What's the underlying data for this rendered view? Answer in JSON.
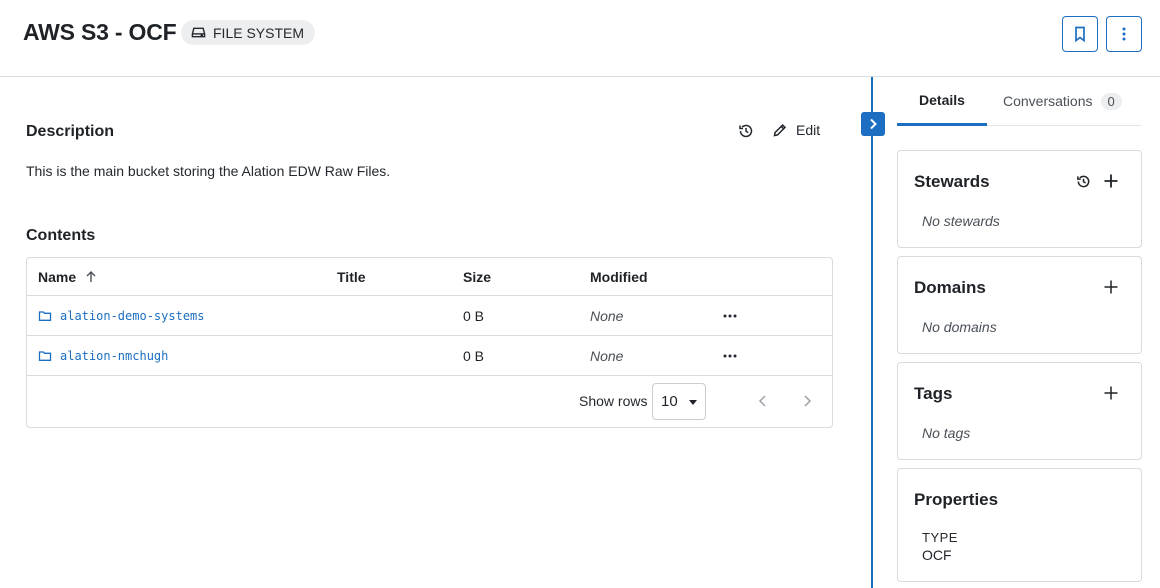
{
  "header": {
    "title": "AWS S3 - OCF",
    "type_chip": "FILE SYSTEM",
    "icons": {
      "type": "drive-icon",
      "bookmark": "bookmark-icon",
      "more": "more-vertical-icon"
    }
  },
  "description": {
    "heading": "Description",
    "text": "This is the main bucket storing the Alation EDW Raw Files.",
    "edit_label": "Edit"
  },
  "contents": {
    "heading": "Contents",
    "columns": [
      "Name",
      "Title",
      "Size",
      "Modified"
    ],
    "rows": [
      {
        "name": "alation-demo-systems",
        "title": "",
        "size": "0 B",
        "modified": "None"
      },
      {
        "name": "alation-nmchugh",
        "title": "",
        "size": "0 B",
        "modified": "None"
      }
    ],
    "pagination": {
      "show_rows_label": "Show rows",
      "rows_value": "10"
    }
  },
  "panel": {
    "tabs": [
      {
        "label": "Details",
        "active": true
      },
      {
        "label": "Conversations",
        "count": "0"
      }
    ],
    "cards": {
      "stewards": {
        "title": "Stewards",
        "empty": "No stewards"
      },
      "domains": {
        "title": "Domains",
        "empty": "No domains"
      },
      "tags": {
        "title": "Tags",
        "empty": "No tags"
      },
      "properties": {
        "title": "Properties",
        "type_label": "TYPE",
        "type_value": "OCF"
      }
    }
  },
  "colors": {
    "accent": "#1b6ec2",
    "border": "#d7dade",
    "chip_bg": "#eceef0"
  }
}
